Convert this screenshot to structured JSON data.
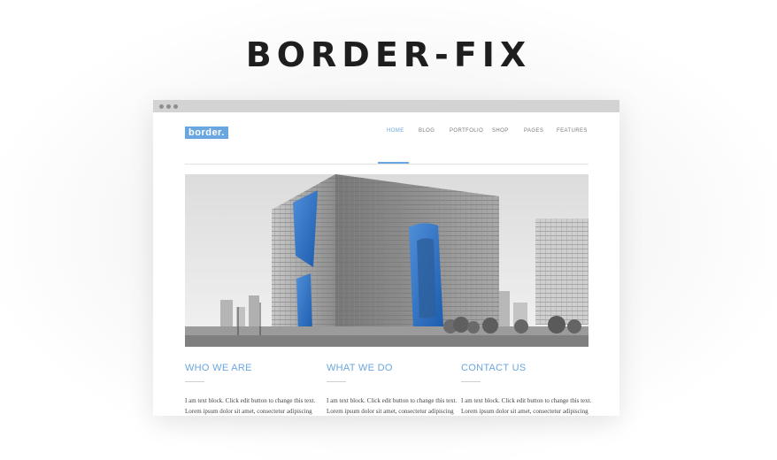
{
  "promo": {
    "title": "BORDER-FIX"
  },
  "site": {
    "logo": "border.",
    "nav": {
      "items": [
        {
          "label": "HOME",
          "active": true
        },
        {
          "label": "BLOG",
          "active": false
        },
        {
          "label": "PORTFOLIO",
          "active": false
        },
        {
          "label": "SHOP",
          "active": false
        },
        {
          "label": "PAGES",
          "active": false
        },
        {
          "label": "FEATURES",
          "active": false
        }
      ]
    },
    "columns": [
      {
        "title": "WHO WE ARE",
        "body": "I am text block. Click edit button to change this text. Lorem ipsum dolor sit amet, consectetur adipiscing elit. Ut elit tellus, luctus nec ullamcorper mattis,"
      },
      {
        "title": "WHAT WE DO",
        "body": "I am text block. Click edit button to change this text. Lorem ipsum dolor sit amet, consectetur adipiscing elit. Ut elit tellus, luctus nec"
      },
      {
        "title": "CONTACT US",
        "body": "I am text block. Click edit button to change this text. Lorem ipsum dolor sit amet, consectetur adipiscing elit. Ut elit tellus, luctus nec ullamcorper mattis,"
      }
    ]
  },
  "colors": {
    "accent": "#6aa6df",
    "window_chrome": "#d3d3d3"
  },
  "icons": [
    "browser-window-dot"
  ]
}
